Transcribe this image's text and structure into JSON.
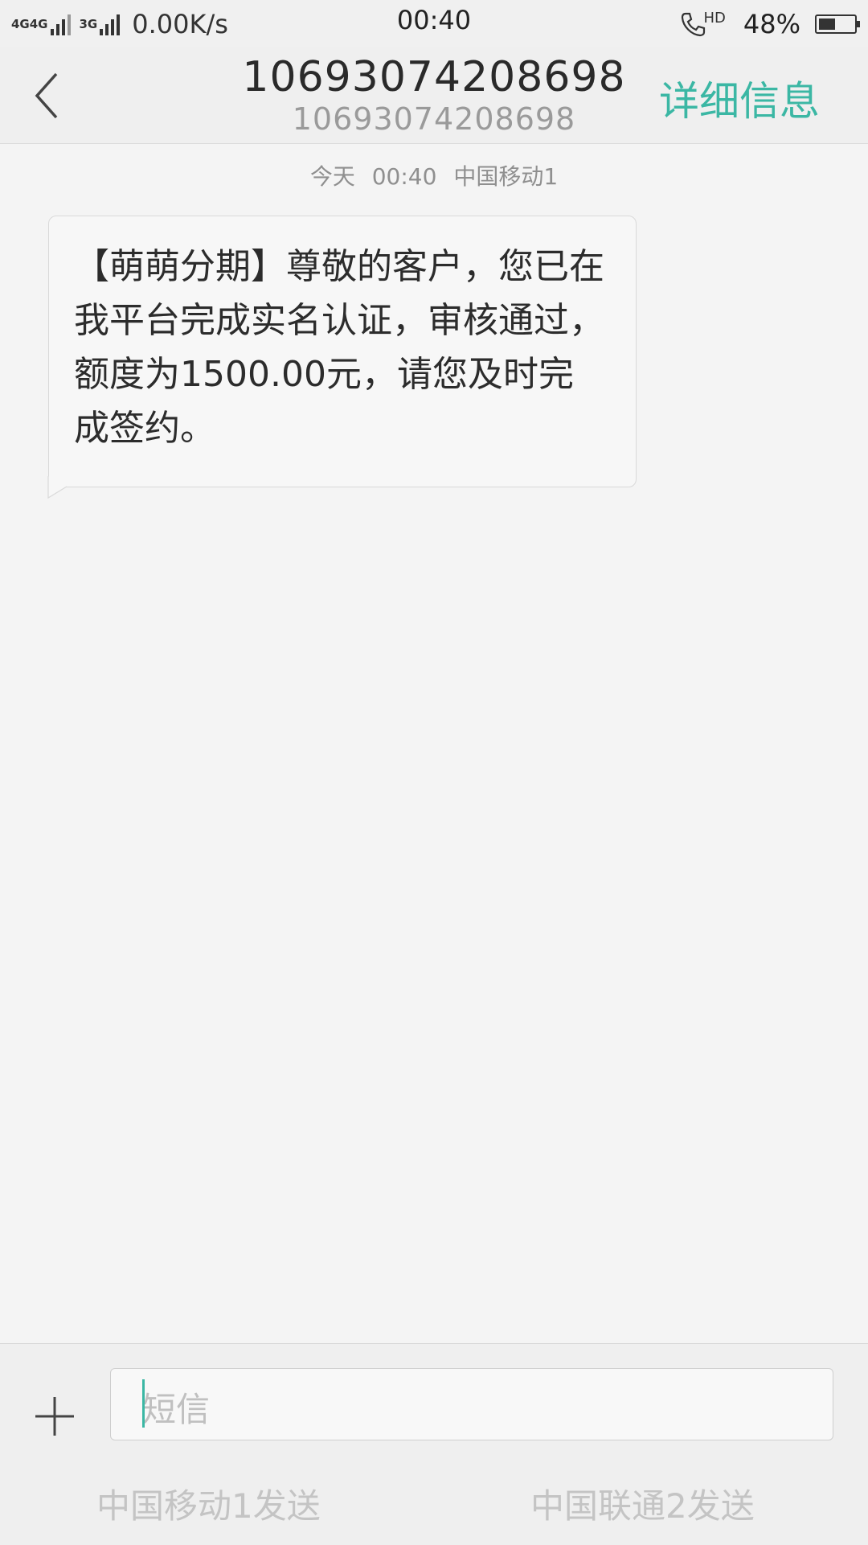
{
  "status_bar": {
    "net1": "4G",
    "net2": "4G",
    "net3": "3G",
    "speed": "0.00K/s",
    "time": "00:40",
    "hd": "HD",
    "battery_percent": "48%",
    "battery_level": 0.48,
    "icons": [
      "signal-icon",
      "call-hd-icon",
      "battery-icon"
    ]
  },
  "header": {
    "title": "10693074208698",
    "subtitle": "10693074208698",
    "details_label": "详细信息",
    "accent_color": "#3bb7a4",
    "back_icon": "chevron-left-icon"
  },
  "conversation": {
    "meta": {
      "day": "今天",
      "time": "00:40",
      "sim": "中国移动1"
    },
    "messages": [
      {
        "text": "【萌萌分期】尊敬的客户，您已在我平台完成实名认证，审核通过，额度为1500.00元，请您及时完成签约。"
      }
    ]
  },
  "composer": {
    "placeholder": "短信",
    "add_icon": "plus-icon",
    "send_sim1": "中国移动1发送",
    "send_sim2": "中国联通2发送"
  }
}
